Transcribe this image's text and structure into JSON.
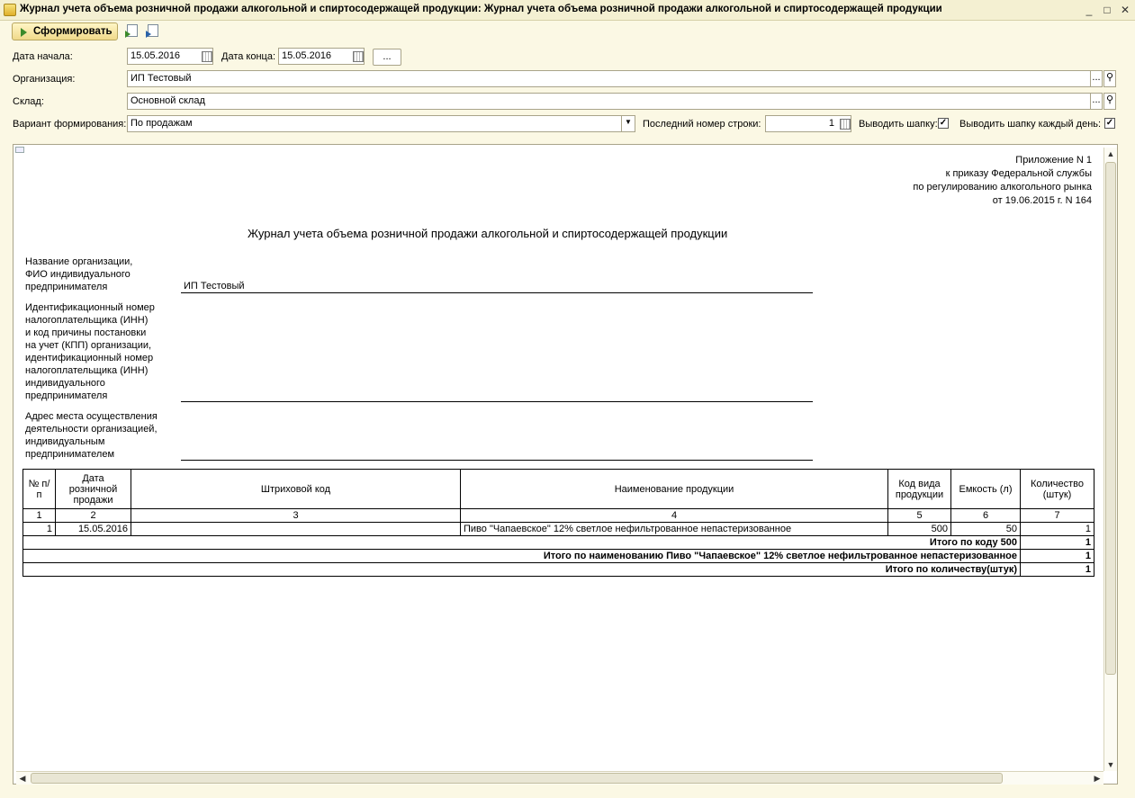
{
  "window": {
    "title": "Журнал учета объема розничной продажи алкогольной и спиртосодержащей продукции: Журнал учета объема розничной продажи алкогольной и спиртосодержащей продукции",
    "minimize": "_",
    "maximize": "□",
    "close": "✕"
  },
  "toolbar": {
    "generate_label": "Сформировать",
    "icons": [
      "export-icon",
      "import-icon"
    ]
  },
  "form": {
    "date_start_label": "Дата начала:",
    "date_start_value": "15.05.2016",
    "date_end_label": "Дата конца:",
    "date_end_value": "15.05.2016",
    "more_button_label": "...",
    "organization_label": "Организация:",
    "organization_value": "ИП Тестовый",
    "warehouse_label": "Склад:",
    "warehouse_value": "Основной склад",
    "variant_label": "Вариант формирования:",
    "variant_value": "По продажам",
    "last_row_label": "Последний номер строки:",
    "last_row_value": "1",
    "show_header_label": "Выводить шапку:",
    "show_header_checked": "✓",
    "show_header_daily_label": "Выводить шапку каждый день:",
    "show_header_daily_checked": "✓",
    "select_button": "...",
    "search_icon": "search-icon"
  },
  "report": {
    "appendix": [
      "Приложение N 1",
      "к приказу Федеральной службы",
      "по регулированию алкогольного рынка",
      "от 19.06.2015 г. N 164"
    ],
    "title": "Журнал учета объема розничной продажи алкогольной и спиртосодержащей продукции",
    "org_name_label": [
      "Название организации,",
      "ФИО индивидуального",
      "предпринимателя"
    ],
    "org_name_value": "ИП Тестовый",
    "inn_label": [
      "Идентификационный номер",
      "налогоплательщика (ИНН)",
      "и код причины постановки",
      "на учет (КПП) организации,",
      "идентификационный номер",
      "налогоплательщика (ИНН)",
      "индивидуального",
      "предпринимателя"
    ],
    "address_label": [
      "Адрес места осуществления",
      "деятельности организацией,",
      "индивидуальным",
      "предпринимателем"
    ],
    "table": {
      "headers": [
        "№ п/п",
        "Дата розничной продажи",
        "Штриховой код",
        "Наименование продукции",
        "Код вида продукции",
        "Емкость (л)",
        "Количество (штук)"
      ],
      "col_numbers": [
        "1",
        "2",
        "3",
        "4",
        "5",
        "6",
        "7"
      ],
      "rows": [
        {
          "num": "1",
          "date": "15.05.2016",
          "barcode": "",
          "name": "Пиво \"Чапаевское\" 12% светлое нефильтрованное непастеризованное",
          "code": "500",
          "capacity": "50",
          "qty": "1"
        }
      ],
      "totals": [
        {
          "label": "Итого по коду 500",
          "value": "1"
        },
        {
          "label": "Итого по наименованию Пиво \"Чапаевское\" 12% светлое нефильтрованное непастеризованное",
          "value": "1"
        },
        {
          "label": "Итого по количеству(штук)",
          "value": "1"
        }
      ]
    }
  }
}
